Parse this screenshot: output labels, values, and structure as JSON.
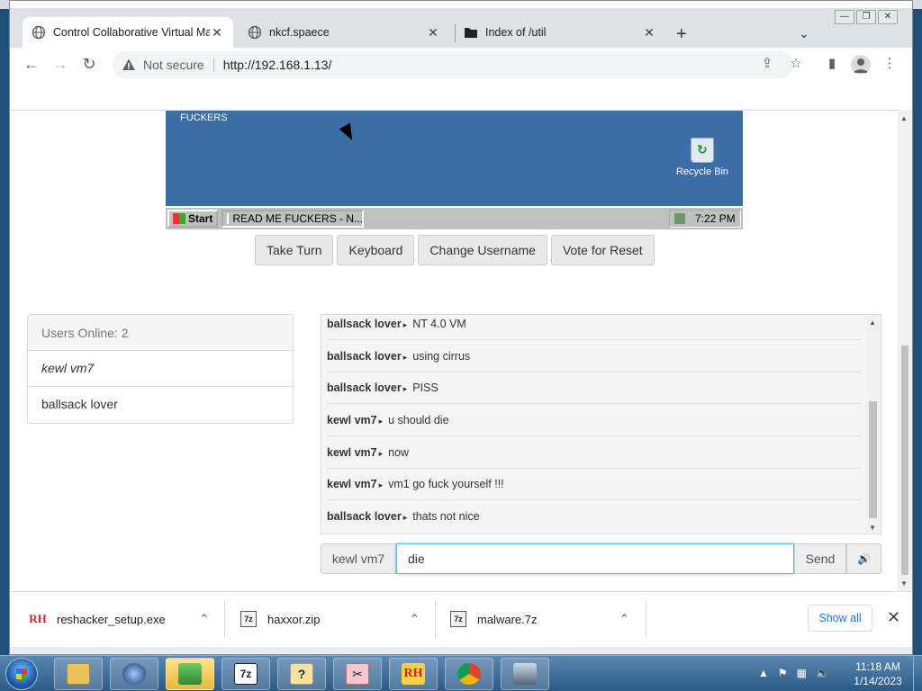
{
  "browser": {
    "tabs": [
      {
        "title": "Control Collaborative Virtual Ma",
        "icon": "globe-icon",
        "active": true
      },
      {
        "title": "nkcf.spaece",
        "icon": "globe-icon",
        "active": false
      },
      {
        "title": "Index of /util",
        "icon": "folder-icon",
        "active": false
      }
    ],
    "omnibox": {
      "security": "Not secure",
      "url": "http://192.168.1.13/"
    }
  },
  "vm": {
    "desktop_text": "FUCKERS",
    "recycle_bin": "Recycle Bin",
    "start_label": "Start",
    "task_item": "READ ME FUCKERS - N...",
    "clock": "7:22 PM"
  },
  "controls": {
    "take_turn": "Take Turn",
    "keyboard": "Keyboard",
    "change_username": "Change Username",
    "vote_reset": "Vote for Reset"
  },
  "users": {
    "header": "Users Online: 2",
    "list": [
      "kewl vm7",
      "ballsack lover"
    ]
  },
  "chat": {
    "messages": [
      {
        "user": "ballsack lover",
        "text": "NT 4.0 VM"
      },
      {
        "user": "ballsack lover",
        "text": "using cirrus"
      },
      {
        "user": "ballsack lover",
        "text": "PISS"
      },
      {
        "user": "kewl vm7",
        "text": "u should die"
      },
      {
        "user": "kewl vm7",
        "text": "now"
      },
      {
        "user": "kewl vm7",
        "text": "vm1 go fuck yourself !!!"
      },
      {
        "user": "ballsack lover",
        "text": "thats not nice"
      }
    ],
    "username": "kewl vm7",
    "input_value": "die",
    "send_label": "Send"
  },
  "downloads": {
    "items": [
      {
        "name": "reshacker_setup.exe",
        "icon": "reshacker-icon"
      },
      {
        "name": "haxxor.zip",
        "icon": "zip-icon"
      },
      {
        "name": "malware.7z",
        "icon": "zip-icon"
      }
    ],
    "show_all": "Show all"
  },
  "taskbar": {
    "time": "11:18 AM",
    "date": "1/14/2023"
  }
}
